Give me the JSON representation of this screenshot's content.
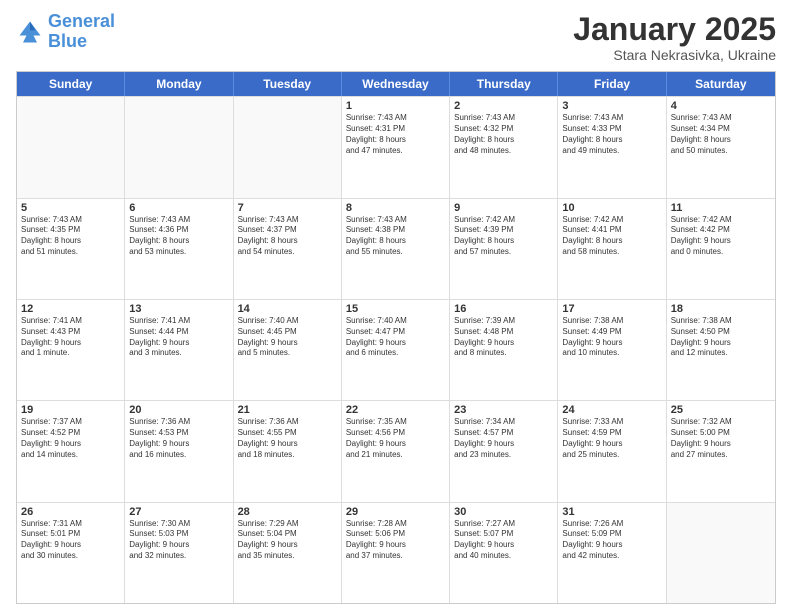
{
  "logo": {
    "line1": "General",
    "line2": "Blue"
  },
  "title": "January 2025",
  "subtitle": "Stara Nekrasivka, Ukraine",
  "header_days": [
    "Sunday",
    "Monday",
    "Tuesday",
    "Wednesday",
    "Thursday",
    "Friday",
    "Saturday"
  ],
  "weeks": [
    [
      {
        "day": "",
        "text": ""
      },
      {
        "day": "",
        "text": ""
      },
      {
        "day": "",
        "text": ""
      },
      {
        "day": "1",
        "text": "Sunrise: 7:43 AM\nSunset: 4:31 PM\nDaylight: 8 hours\nand 47 minutes."
      },
      {
        "day": "2",
        "text": "Sunrise: 7:43 AM\nSunset: 4:32 PM\nDaylight: 8 hours\nand 48 minutes."
      },
      {
        "day": "3",
        "text": "Sunrise: 7:43 AM\nSunset: 4:33 PM\nDaylight: 8 hours\nand 49 minutes."
      },
      {
        "day": "4",
        "text": "Sunrise: 7:43 AM\nSunset: 4:34 PM\nDaylight: 8 hours\nand 50 minutes."
      }
    ],
    [
      {
        "day": "5",
        "text": "Sunrise: 7:43 AM\nSunset: 4:35 PM\nDaylight: 8 hours\nand 51 minutes."
      },
      {
        "day": "6",
        "text": "Sunrise: 7:43 AM\nSunset: 4:36 PM\nDaylight: 8 hours\nand 53 minutes."
      },
      {
        "day": "7",
        "text": "Sunrise: 7:43 AM\nSunset: 4:37 PM\nDaylight: 8 hours\nand 54 minutes."
      },
      {
        "day": "8",
        "text": "Sunrise: 7:43 AM\nSunset: 4:38 PM\nDaylight: 8 hours\nand 55 minutes."
      },
      {
        "day": "9",
        "text": "Sunrise: 7:42 AM\nSunset: 4:39 PM\nDaylight: 8 hours\nand 57 minutes."
      },
      {
        "day": "10",
        "text": "Sunrise: 7:42 AM\nSunset: 4:41 PM\nDaylight: 8 hours\nand 58 minutes."
      },
      {
        "day": "11",
        "text": "Sunrise: 7:42 AM\nSunset: 4:42 PM\nDaylight: 9 hours\nand 0 minutes."
      }
    ],
    [
      {
        "day": "12",
        "text": "Sunrise: 7:41 AM\nSunset: 4:43 PM\nDaylight: 9 hours\nand 1 minute."
      },
      {
        "day": "13",
        "text": "Sunrise: 7:41 AM\nSunset: 4:44 PM\nDaylight: 9 hours\nand 3 minutes."
      },
      {
        "day": "14",
        "text": "Sunrise: 7:40 AM\nSunset: 4:45 PM\nDaylight: 9 hours\nand 5 minutes."
      },
      {
        "day": "15",
        "text": "Sunrise: 7:40 AM\nSunset: 4:47 PM\nDaylight: 9 hours\nand 6 minutes."
      },
      {
        "day": "16",
        "text": "Sunrise: 7:39 AM\nSunset: 4:48 PM\nDaylight: 9 hours\nand 8 minutes."
      },
      {
        "day": "17",
        "text": "Sunrise: 7:38 AM\nSunset: 4:49 PM\nDaylight: 9 hours\nand 10 minutes."
      },
      {
        "day": "18",
        "text": "Sunrise: 7:38 AM\nSunset: 4:50 PM\nDaylight: 9 hours\nand 12 minutes."
      }
    ],
    [
      {
        "day": "19",
        "text": "Sunrise: 7:37 AM\nSunset: 4:52 PM\nDaylight: 9 hours\nand 14 minutes."
      },
      {
        "day": "20",
        "text": "Sunrise: 7:36 AM\nSunset: 4:53 PM\nDaylight: 9 hours\nand 16 minutes."
      },
      {
        "day": "21",
        "text": "Sunrise: 7:36 AM\nSunset: 4:55 PM\nDaylight: 9 hours\nand 18 minutes."
      },
      {
        "day": "22",
        "text": "Sunrise: 7:35 AM\nSunset: 4:56 PM\nDaylight: 9 hours\nand 21 minutes."
      },
      {
        "day": "23",
        "text": "Sunrise: 7:34 AM\nSunset: 4:57 PM\nDaylight: 9 hours\nand 23 minutes."
      },
      {
        "day": "24",
        "text": "Sunrise: 7:33 AM\nSunset: 4:59 PM\nDaylight: 9 hours\nand 25 minutes."
      },
      {
        "day": "25",
        "text": "Sunrise: 7:32 AM\nSunset: 5:00 PM\nDaylight: 9 hours\nand 27 minutes."
      }
    ],
    [
      {
        "day": "26",
        "text": "Sunrise: 7:31 AM\nSunset: 5:01 PM\nDaylight: 9 hours\nand 30 minutes."
      },
      {
        "day": "27",
        "text": "Sunrise: 7:30 AM\nSunset: 5:03 PM\nDaylight: 9 hours\nand 32 minutes."
      },
      {
        "day": "28",
        "text": "Sunrise: 7:29 AM\nSunset: 5:04 PM\nDaylight: 9 hours\nand 35 minutes."
      },
      {
        "day": "29",
        "text": "Sunrise: 7:28 AM\nSunset: 5:06 PM\nDaylight: 9 hours\nand 37 minutes."
      },
      {
        "day": "30",
        "text": "Sunrise: 7:27 AM\nSunset: 5:07 PM\nDaylight: 9 hours\nand 40 minutes."
      },
      {
        "day": "31",
        "text": "Sunrise: 7:26 AM\nSunset: 5:09 PM\nDaylight: 9 hours\nand 42 minutes."
      },
      {
        "day": "",
        "text": ""
      }
    ]
  ]
}
